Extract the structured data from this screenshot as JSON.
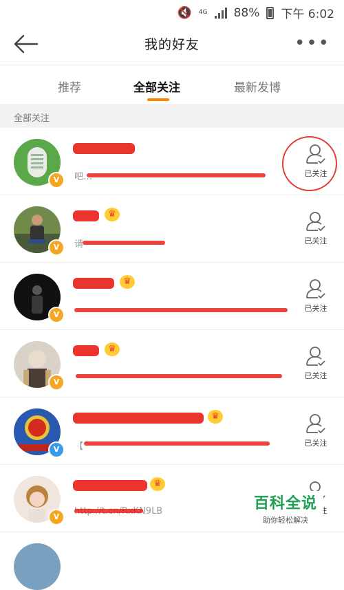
{
  "status_bar": {
    "network": "4G",
    "battery": "88%",
    "time": "下午 6:02"
  },
  "header": {
    "title": "我的好友"
  },
  "tabs": [
    {
      "label": "推荐"
    },
    {
      "label": "全部关注",
      "active": true
    },
    {
      "label": "最新发博"
    }
  ],
  "section": {
    "label": "全部关注"
  },
  "follow_label": "已关注",
  "rows": [
    {
      "badge": "v-orange",
      "desc": "吧…",
      "highlighted": true
    },
    {
      "badge": "v-orange",
      "desc": "请"
    },
    {
      "badge": "v-orange",
      "desc": ""
    },
    {
      "badge": "v-orange",
      "desc": ""
    },
    {
      "badge": "v-blue",
      "desc": "【"
    },
    {
      "badge": "v-orange",
      "desc": "http://t.cn/RxKN9LB"
    }
  ],
  "watermark": {
    "title": "百科全说",
    "subtitle": "助你轻松解决"
  },
  "colors": {
    "accent": "#ff8200",
    "redact": "#e8231c",
    "verified_orange": "#f5a623",
    "verified_blue": "#3a9be8",
    "watermark": "#1fa055"
  }
}
